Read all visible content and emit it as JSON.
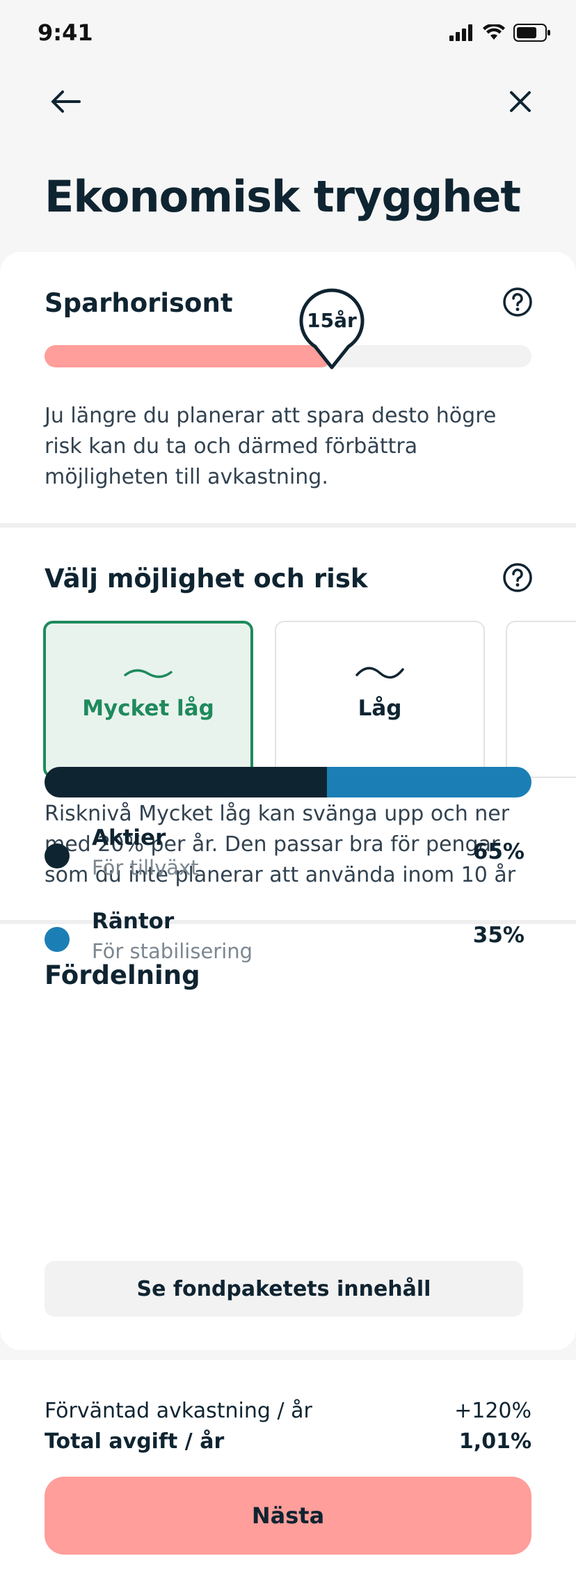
{
  "status_bar": {
    "time": "9:41"
  },
  "header": {
    "title": "Ekonomisk trygghet"
  },
  "savings_horizon": {
    "title": "Sparhorisont",
    "value_label": "15år",
    "level": 0.59,
    "description": "Ju längre du planerar att spara desto högre risk kan du ta och därmed förbättra möjligheten till avkastning."
  },
  "risk": {
    "title": "Välj möjlighet och risk",
    "options": [
      {
        "label": "Mycket låg",
        "selected": true
      },
      {
        "label": "Låg",
        "selected": false
      },
      {
        "label": "",
        "selected": false
      }
    ],
    "description": "Risknivå Mycket låg kan svänga upp och ner med 20% per år. Den passar bra för pengar som du inte planerar att använda inom 10 år"
  },
  "allocation": {
    "title": "Fördelning",
    "items": [
      {
        "name": "Aktier",
        "desc": "För tillväxt",
        "percent_label": "65%",
        "percent": 58,
        "color": "#0f2431"
      },
      {
        "name": "Räntor",
        "desc": "För stabilisering",
        "percent_label": "35%",
        "percent": 42,
        "color": "#1b7fb5"
      }
    ],
    "button_label": "Se fondpaketets innehåll"
  },
  "summary": {
    "expected_return_label": "Förväntad avkastning / år",
    "expected_return_value": "+120%",
    "total_fee_label": "Total avgift / år",
    "total_fee_value": "1,01%"
  },
  "next_button_label": "Nästa",
  "colors": {
    "accent_pink": "#ff9e9a",
    "selected_green": "#1f8a5c",
    "navy": "#0f2431",
    "blue": "#1b7fb5"
  }
}
